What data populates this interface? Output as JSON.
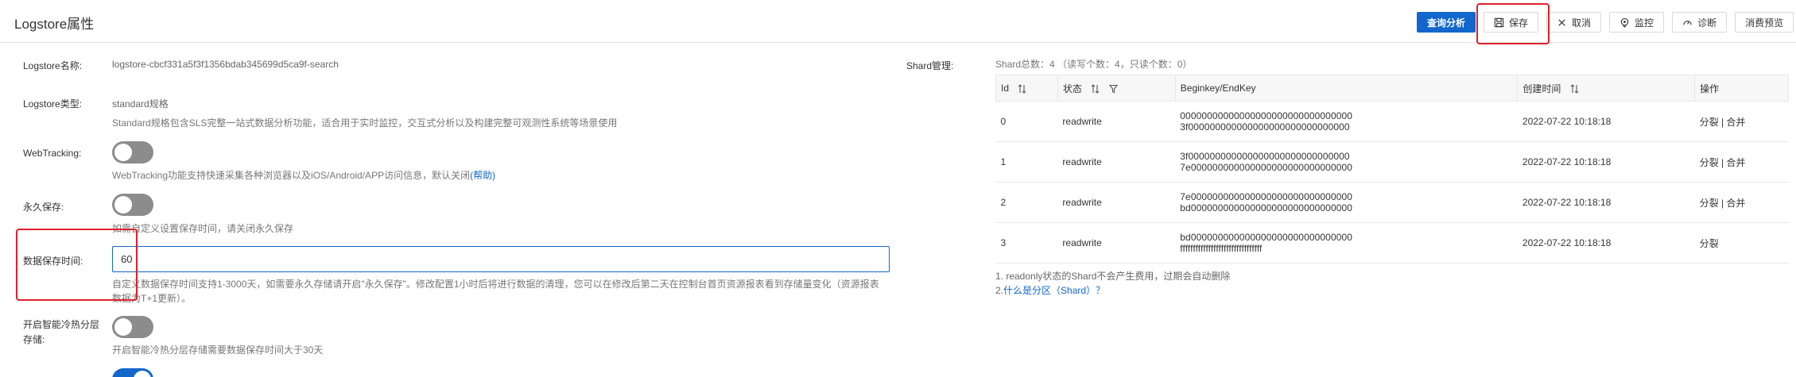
{
  "header": {
    "title": "Logstore属性",
    "buttons": {
      "query": "查询分析",
      "save": "保存",
      "cancel": "取消",
      "monitor": "监控",
      "diagnose": "诊断",
      "preview": "消费预览"
    }
  },
  "form": {
    "name": {
      "label": "Logstore名称:",
      "value": "logstore-cbcf331a5f3f1356bdab345699d5ca9f-search"
    },
    "type": {
      "label": "Logstore类型:",
      "value": "standard规格",
      "desc": "Standard规格包含SLS完整一站式数据分析功能，适合用于实时监控，交互式分析以及构建完整可观测性系统等场景使用"
    },
    "webtracking": {
      "label": "WebTracking:",
      "enabled": false,
      "desc": "WebTracking功能支持快速采集各种浏览器以及iOS/Android/APP访问信息，默认关闭",
      "help": "(帮助)"
    },
    "permanent": {
      "label": "永久保存:",
      "enabled": false,
      "desc": "如需自定义设置保存时间，请关闭永久保存"
    },
    "retention": {
      "label": "数据保存时间:",
      "value": "60",
      "desc_line1": "自定义数据保存时间支持1-3000天，如需要永久存储请开启\"永久保存\"。修改配置1小时后将进行数据的清理，您可以在修改后第二天在控制台首页资源报表看到存储量变化（资源报表",
      "desc_line2": "数据为T+1更新）。"
    },
    "tiered": {
      "label_line1": "开启智能冷热分层",
      "label_line2": "存储:",
      "enabled": false,
      "desc": "开启智能冷热分层存储需要数据保存时间大于30天"
    },
    "last_toggle": {
      "enabled": true
    }
  },
  "shard": {
    "label": "Shard管理:",
    "summary": "Shard总数：4 （读写个数：4，只读个数：0）",
    "columns": [
      "Id",
      "状态",
      "Beginkey/EndKey",
      "创建时间",
      "操作"
    ],
    "rows": [
      {
        "id": "0",
        "status": "readwrite",
        "begin": "00000000000000000000000000000000",
        "end": "3f000000000000000000000000000000",
        "time": "2022-07-22 10:18:18",
        "actions": "分裂 | 合并"
      },
      {
        "id": "1",
        "status": "readwrite",
        "begin": "3f000000000000000000000000000000",
        "end": "7e000000000000000000000000000000",
        "time": "2022-07-22 10:18:18",
        "actions": "分裂 | 合并"
      },
      {
        "id": "2",
        "status": "readwrite",
        "begin": "7e000000000000000000000000000000",
        "end": "bd000000000000000000000000000000",
        "time": "2022-07-22 10:18:18",
        "actions": "分裂 | 合并"
      },
      {
        "id": "3",
        "status": "readwrite",
        "begin": "bd000000000000000000000000000000",
        "end": "ffffffffffffffffffffffffffffffff",
        "time": "2022-07-22 10:18:18",
        "actions": "分裂"
      }
    ],
    "note1": "1. readonly状态的Shard不会产生费用，过期会自动删除",
    "note2_prefix": "2.",
    "note2_link": "什么是分区（Shard）？"
  },
  "colors": {
    "primary": "#1366cb",
    "highlight": "#e0202a"
  }
}
